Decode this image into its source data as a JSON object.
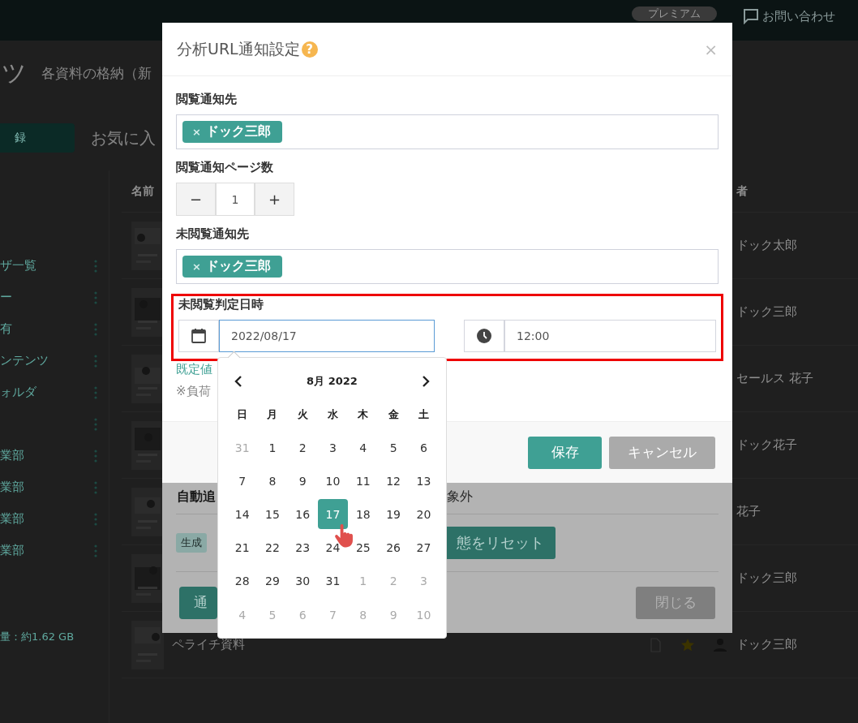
{
  "top_bar": {
    "premium_badge": "プレミアム",
    "contact_link": "お問い合わせ"
  },
  "page": {
    "title": "ツ",
    "subtitle": "各資料の格納（新",
    "register_button": "録",
    "favorites_label": "お気に入"
  },
  "sidebar": {
    "items": [
      {
        "kind": "entry",
        "label": "ザ一覧"
      },
      {
        "kind": "entry",
        "label": "ー"
      },
      {
        "kind": "entry",
        "label": "有"
      },
      {
        "kind": "entry",
        "label": "ンテンツ"
      },
      {
        "kind": "entry",
        "label": "ォルダ"
      },
      {
        "kind": "actions-only"
      },
      {
        "kind": "entry",
        "label": "業部"
      },
      {
        "kind": "entry",
        "label": "業部"
      },
      {
        "kind": "entry",
        "label": "業部"
      },
      {
        "kind": "entry",
        "label": "業部"
      }
    ],
    "storage": "量：約1.62 GB"
  },
  "table": {
    "columns": [
      "名前",
      "者"
    ],
    "rows": [
      {
        "owner": "ドック太郎"
      },
      {
        "owner": "ドック三郎"
      },
      {
        "owner": "セールス 花子"
      },
      {
        "owner": "ドック花子"
      },
      {
        "owner": "花子"
      },
      {
        "owner": "ドック三郎"
      },
      {
        "name": "ペライチ資料",
        "owner": "ドック三郎"
      }
    ]
  },
  "background_dialog": {
    "heading_parts": [
      "自動追",
      "象外"
    ],
    "badge": "生成",
    "reset_button": "態をリセット",
    "notify_button": "通",
    "close_button": "閉じる"
  },
  "dialog": {
    "title": "分析URL通知設定",
    "help": "?",
    "close": "×",
    "fields": [
      {
        "kind": "tags",
        "label": "閲覧通知先",
        "tags": [
          {
            "remove": "×",
            "name": "ドック三郎"
          }
        ]
      },
      {
        "kind": "stepper",
        "label": "閲覧通知ページ数",
        "minus": "−",
        "value": "1",
        "plus": "+"
      },
      {
        "kind": "tags",
        "label": "未閲覧通知先",
        "tags": [
          {
            "remove": "×",
            "name": "ドック三郎"
          }
        ]
      },
      {
        "kind": "datetime",
        "label": "未閲覧判定日時",
        "highlighted": true,
        "date": "2022/08/17",
        "date_focused": true,
        "time": "12:00"
      }
    ],
    "default_link": "既定値",
    "note": "※負荷",
    "buttons": [
      {
        "label": "保存",
        "kind": "primary"
      },
      {
        "label": "キャンセル",
        "kind": "secondary"
      }
    ]
  },
  "calendar": {
    "title": "8月 2022",
    "weekdays": [
      "日",
      "月",
      "火",
      "水",
      "木",
      "金",
      "土"
    ],
    "weeks": [
      [
        {
          "day": "31",
          "outside": true,
          "selected": false
        },
        {
          "day": "1",
          "outside": false,
          "selected": false
        },
        {
          "day": "2",
          "outside": false,
          "selected": false
        },
        {
          "day": "3",
          "outside": false,
          "selected": false
        },
        {
          "day": "4",
          "outside": false,
          "selected": false
        },
        {
          "day": "5",
          "outside": false,
          "selected": false
        },
        {
          "day": "6",
          "outside": false,
          "selected": false
        }
      ],
      [
        {
          "day": "7",
          "outside": false,
          "selected": false
        },
        {
          "day": "8",
          "outside": false,
          "selected": false
        },
        {
          "day": "9",
          "outside": false,
          "selected": false
        },
        {
          "day": "10",
          "outside": false,
          "selected": false
        },
        {
          "day": "11",
          "outside": false,
          "selected": false
        },
        {
          "day": "12",
          "outside": false,
          "selected": false
        },
        {
          "day": "13",
          "outside": false,
          "selected": false
        }
      ],
      [
        {
          "day": "14",
          "outside": false,
          "selected": false
        },
        {
          "day": "15",
          "outside": false,
          "selected": false
        },
        {
          "day": "16",
          "outside": false,
          "selected": false
        },
        {
          "day": "17",
          "outside": false,
          "selected": true
        },
        {
          "day": "18",
          "outside": false,
          "selected": false
        },
        {
          "day": "19",
          "outside": false,
          "selected": false
        },
        {
          "day": "20",
          "outside": false,
          "selected": false
        }
      ],
      [
        {
          "day": "21",
          "outside": false,
          "selected": false
        },
        {
          "day": "22",
          "outside": false,
          "selected": false
        },
        {
          "day": "23",
          "outside": false,
          "selected": false
        },
        {
          "day": "24",
          "outside": false,
          "selected": false
        },
        {
          "day": "25",
          "outside": false,
          "selected": false
        },
        {
          "day": "26",
          "outside": false,
          "selected": false
        },
        {
          "day": "27",
          "outside": false,
          "selected": false
        }
      ],
      [
        {
          "day": "28",
          "outside": false,
          "selected": false
        },
        {
          "day": "29",
          "outside": false,
          "selected": false
        },
        {
          "day": "30",
          "outside": false,
          "selected": false
        },
        {
          "day": "31",
          "outside": false,
          "selected": false
        },
        {
          "day": "1",
          "outside": true,
          "selected": false
        },
        {
          "day": "2",
          "outside": true,
          "selected": false
        },
        {
          "day": "3",
          "outside": true,
          "selected": false
        }
      ],
      [
        {
          "day": "4",
          "outside": true,
          "selected": false
        },
        {
          "day": "5",
          "outside": true,
          "selected": false
        },
        {
          "day": "6",
          "outside": true,
          "selected": false
        },
        {
          "day": "7",
          "outside": true,
          "selected": false
        },
        {
          "day": "8",
          "outside": true,
          "selected": false
        },
        {
          "day": "9",
          "outside": true,
          "selected": false
        },
        {
          "day": "10",
          "outside": true,
          "selected": false
        }
      ]
    ]
  }
}
